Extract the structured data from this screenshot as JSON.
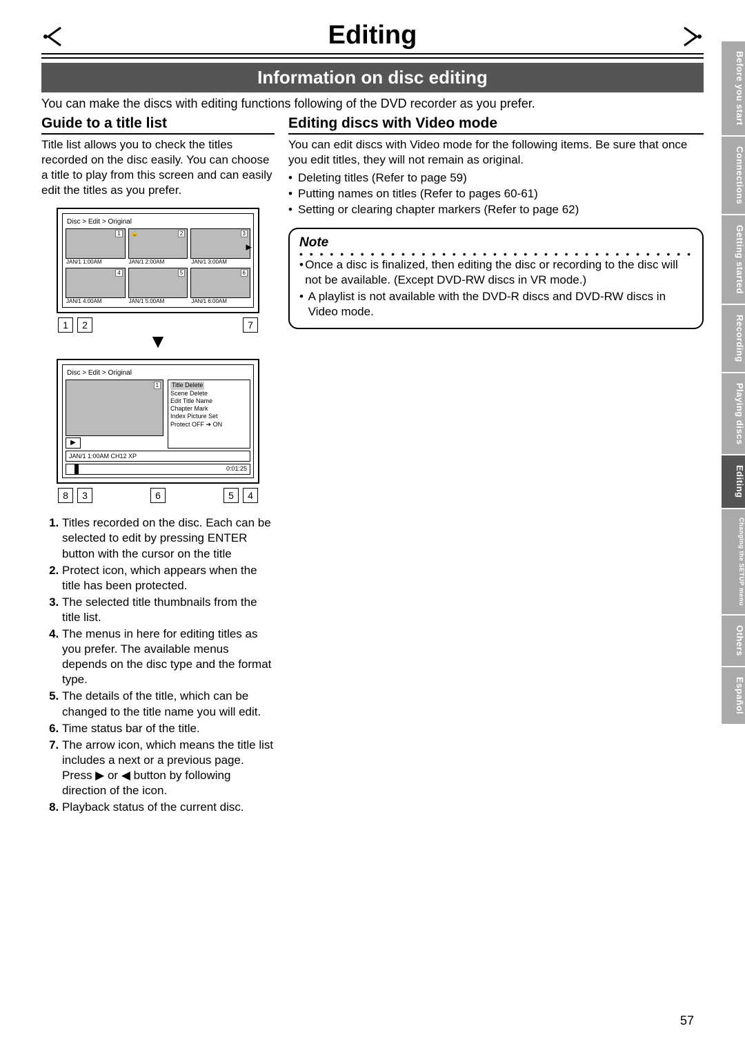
{
  "header": {
    "title": "Editing",
    "subtitle": "Information on disc editing"
  },
  "intro": "You can make the discs with editing functions following of the DVD recorder as you prefer.",
  "left": {
    "title": "Guide to a title list",
    "para": "Title list allows you to check the titles recorded on the disc easily. You can choose a title to play from this screen and can easily edit the titles as you prefer.",
    "panel1": {
      "breadcrumb": "Disc > Edit > Original",
      "thumbs": [
        {
          "idx": "1",
          "label": "JAN/1  1:00AM",
          "lock": ""
        },
        {
          "idx": "2",
          "label": "JAN/1  2:00AM",
          "lock": "🔒"
        },
        {
          "idx": "3",
          "label": "JAN/1  3:00AM",
          "lock": ""
        },
        {
          "idx": "4",
          "label": "JAN/1  4:00AM",
          "lock": ""
        },
        {
          "idx": "5",
          "label": "JAN/1  5:00AM",
          "lock": ""
        },
        {
          "idx": "6",
          "label": "JAN/1  6:00AM",
          "lock": ""
        }
      ],
      "calloutsLeft": [
        "1",
        "2"
      ],
      "calloutsRight": [
        "7"
      ]
    },
    "panel2": {
      "breadcrumb": "Disc > Edit > Original",
      "idx": "1",
      "menu": [
        "Title Delete",
        "Scene Delete",
        "Edit Title Name",
        "Chapter Mark",
        "Index Picture Set",
        "Protect OFF ➔ ON"
      ],
      "infoLine": "JAN/1  1:00AM  CH12    XP",
      "time": "0:01:25",
      "calloutsLeft": [
        "8",
        "3"
      ],
      "calloutsMid": [
        "6"
      ],
      "calloutsRight": [
        "5",
        "4"
      ]
    },
    "list": [
      "Titles recorded on the disc. Each can be selected to edit by pressing ENTER button with the cursor on the title",
      "Protect icon, which appears when the title has been protected.",
      "The selected title thumbnails from the title list.",
      "The menus in here for editing titles as you prefer. The available menus depends on the disc type and the format type.",
      "The details of the title, which can be changed to the title name you will edit.",
      "Time status bar of the title.",
      "The arrow icon, which means the title list includes a next or a previous page. Press ▶ or ◀ button by following direction of the icon.",
      "Playback status of the current disc."
    ]
  },
  "right": {
    "title": "Editing discs with Video mode",
    "para": "You can edit discs with Video mode for the following items. Be sure that once you edit titles, they will not remain as original.",
    "bullets": [
      "Deleting titles (Refer to page 59)",
      "Putting names on titles (Refer to pages 60-61)",
      "Setting or clearing chapter markers (Refer to page 62)"
    ],
    "noteTitle": "Note",
    "noteItems": [
      "Once a disc is finalized, then editing the disc or recording to the disc will not be available. (Except DVD-RW discs in VR mode.)",
      "A playlist is not available with the DVD-R discs and DVD-RW discs in Video mode."
    ]
  },
  "tabs": [
    "Before you start",
    "Connections",
    "Getting started",
    "Recording",
    "Playing discs",
    "Editing",
    "Changing the SETUP menu",
    "Others",
    "Español"
  ],
  "activeTab": "Editing",
  "pageNumber": "57"
}
